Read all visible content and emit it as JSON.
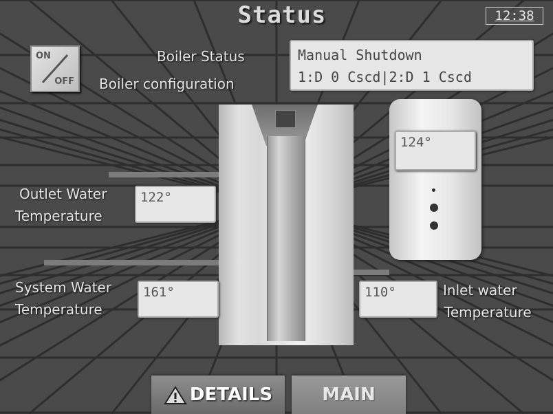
{
  "header": {
    "title": "Status",
    "clock": "12:38"
  },
  "power_switch": {
    "on_label": "ON",
    "off_label": "OFF"
  },
  "boiler": {
    "status_label": "Boiler Status",
    "status_value": "Manual Shutdown",
    "config_label": "Boiler configuration",
    "config_value": "1:D 0 Cscd|2:D 1 Cscd"
  },
  "tank": {
    "temperature": "124°"
  },
  "outlet": {
    "label_line1": "Outlet Water",
    "label_line2": "Temperature",
    "value": "122°"
  },
  "system": {
    "label_line1": "System Water",
    "label_line2": "Temperature",
    "value": "161°"
  },
  "inlet": {
    "label_line1": "Inlet water",
    "label_line2": "Temperature",
    "value": "110°"
  },
  "nav": {
    "details_label": "DETAILS",
    "main_label": "MAIN"
  },
  "colors": {
    "background": "#454545",
    "panel": "#e6e6e6",
    "text": "#e4e4e4",
    "button": "#7a7a7a"
  }
}
